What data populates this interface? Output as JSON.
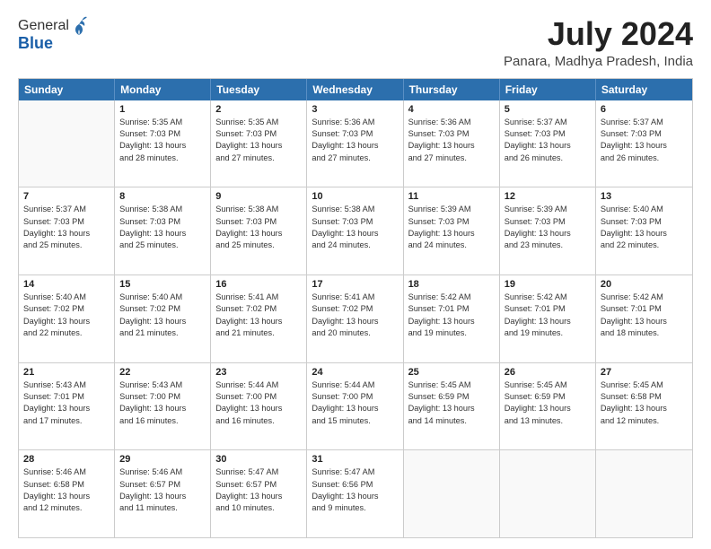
{
  "logo": {
    "general": "General",
    "blue": "Blue"
  },
  "title": "July 2024",
  "location": "Panara, Madhya Pradesh, India",
  "headers": [
    "Sunday",
    "Monday",
    "Tuesday",
    "Wednesday",
    "Thursday",
    "Friday",
    "Saturday"
  ],
  "rows": [
    [
      {
        "day": "",
        "lines": []
      },
      {
        "day": "1",
        "lines": [
          "Sunrise: 5:35 AM",
          "Sunset: 7:03 PM",
          "Daylight: 13 hours",
          "and 28 minutes."
        ]
      },
      {
        "day": "2",
        "lines": [
          "Sunrise: 5:35 AM",
          "Sunset: 7:03 PM",
          "Daylight: 13 hours",
          "and 27 minutes."
        ]
      },
      {
        "day": "3",
        "lines": [
          "Sunrise: 5:36 AM",
          "Sunset: 7:03 PM",
          "Daylight: 13 hours",
          "and 27 minutes."
        ]
      },
      {
        "day": "4",
        "lines": [
          "Sunrise: 5:36 AM",
          "Sunset: 7:03 PM",
          "Daylight: 13 hours",
          "and 27 minutes."
        ]
      },
      {
        "day": "5",
        "lines": [
          "Sunrise: 5:37 AM",
          "Sunset: 7:03 PM",
          "Daylight: 13 hours",
          "and 26 minutes."
        ]
      },
      {
        "day": "6",
        "lines": [
          "Sunrise: 5:37 AM",
          "Sunset: 7:03 PM",
          "Daylight: 13 hours",
          "and 26 minutes."
        ]
      }
    ],
    [
      {
        "day": "7",
        "lines": [
          "Sunrise: 5:37 AM",
          "Sunset: 7:03 PM",
          "Daylight: 13 hours",
          "and 25 minutes."
        ]
      },
      {
        "day": "8",
        "lines": [
          "Sunrise: 5:38 AM",
          "Sunset: 7:03 PM",
          "Daylight: 13 hours",
          "and 25 minutes."
        ]
      },
      {
        "day": "9",
        "lines": [
          "Sunrise: 5:38 AM",
          "Sunset: 7:03 PM",
          "Daylight: 13 hours",
          "and 25 minutes."
        ]
      },
      {
        "day": "10",
        "lines": [
          "Sunrise: 5:38 AM",
          "Sunset: 7:03 PM",
          "Daylight: 13 hours",
          "and 24 minutes."
        ]
      },
      {
        "day": "11",
        "lines": [
          "Sunrise: 5:39 AM",
          "Sunset: 7:03 PM",
          "Daylight: 13 hours",
          "and 24 minutes."
        ]
      },
      {
        "day": "12",
        "lines": [
          "Sunrise: 5:39 AM",
          "Sunset: 7:03 PM",
          "Daylight: 13 hours",
          "and 23 minutes."
        ]
      },
      {
        "day": "13",
        "lines": [
          "Sunrise: 5:40 AM",
          "Sunset: 7:03 PM",
          "Daylight: 13 hours",
          "and 22 minutes."
        ]
      }
    ],
    [
      {
        "day": "14",
        "lines": [
          "Sunrise: 5:40 AM",
          "Sunset: 7:02 PM",
          "Daylight: 13 hours",
          "and 22 minutes."
        ]
      },
      {
        "day": "15",
        "lines": [
          "Sunrise: 5:40 AM",
          "Sunset: 7:02 PM",
          "Daylight: 13 hours",
          "and 21 minutes."
        ]
      },
      {
        "day": "16",
        "lines": [
          "Sunrise: 5:41 AM",
          "Sunset: 7:02 PM",
          "Daylight: 13 hours",
          "and 21 minutes."
        ]
      },
      {
        "day": "17",
        "lines": [
          "Sunrise: 5:41 AM",
          "Sunset: 7:02 PM",
          "Daylight: 13 hours",
          "and 20 minutes."
        ]
      },
      {
        "day": "18",
        "lines": [
          "Sunrise: 5:42 AM",
          "Sunset: 7:01 PM",
          "Daylight: 13 hours",
          "and 19 minutes."
        ]
      },
      {
        "day": "19",
        "lines": [
          "Sunrise: 5:42 AM",
          "Sunset: 7:01 PM",
          "Daylight: 13 hours",
          "and 19 minutes."
        ]
      },
      {
        "day": "20",
        "lines": [
          "Sunrise: 5:42 AM",
          "Sunset: 7:01 PM",
          "Daylight: 13 hours",
          "and 18 minutes."
        ]
      }
    ],
    [
      {
        "day": "21",
        "lines": [
          "Sunrise: 5:43 AM",
          "Sunset: 7:01 PM",
          "Daylight: 13 hours",
          "and 17 minutes."
        ]
      },
      {
        "day": "22",
        "lines": [
          "Sunrise: 5:43 AM",
          "Sunset: 7:00 PM",
          "Daylight: 13 hours",
          "and 16 minutes."
        ]
      },
      {
        "day": "23",
        "lines": [
          "Sunrise: 5:44 AM",
          "Sunset: 7:00 PM",
          "Daylight: 13 hours",
          "and 16 minutes."
        ]
      },
      {
        "day": "24",
        "lines": [
          "Sunrise: 5:44 AM",
          "Sunset: 7:00 PM",
          "Daylight: 13 hours",
          "and 15 minutes."
        ]
      },
      {
        "day": "25",
        "lines": [
          "Sunrise: 5:45 AM",
          "Sunset: 6:59 PM",
          "Daylight: 13 hours",
          "and 14 minutes."
        ]
      },
      {
        "day": "26",
        "lines": [
          "Sunrise: 5:45 AM",
          "Sunset: 6:59 PM",
          "Daylight: 13 hours",
          "and 13 minutes."
        ]
      },
      {
        "day": "27",
        "lines": [
          "Sunrise: 5:45 AM",
          "Sunset: 6:58 PM",
          "Daylight: 13 hours",
          "and 12 minutes."
        ]
      }
    ],
    [
      {
        "day": "28",
        "lines": [
          "Sunrise: 5:46 AM",
          "Sunset: 6:58 PM",
          "Daylight: 13 hours",
          "and 12 minutes."
        ]
      },
      {
        "day": "29",
        "lines": [
          "Sunrise: 5:46 AM",
          "Sunset: 6:57 PM",
          "Daylight: 13 hours",
          "and 11 minutes."
        ]
      },
      {
        "day": "30",
        "lines": [
          "Sunrise: 5:47 AM",
          "Sunset: 6:57 PM",
          "Daylight: 13 hours",
          "and 10 minutes."
        ]
      },
      {
        "day": "31",
        "lines": [
          "Sunrise: 5:47 AM",
          "Sunset: 6:56 PM",
          "Daylight: 13 hours",
          "and 9 minutes."
        ]
      },
      {
        "day": "",
        "lines": []
      },
      {
        "day": "",
        "lines": []
      },
      {
        "day": "",
        "lines": []
      }
    ]
  ]
}
